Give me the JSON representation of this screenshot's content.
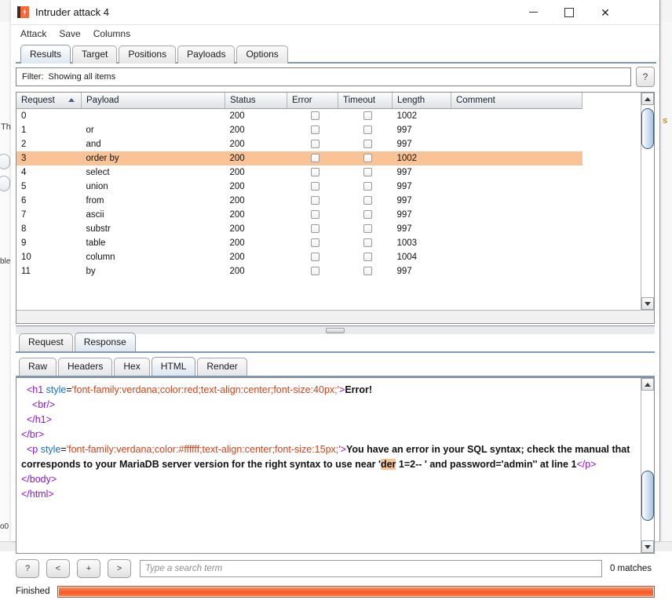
{
  "window": {
    "title": "Intruder attack 4",
    "icon": "burp-icon",
    "minimize": "–",
    "maximize": "□",
    "close": "✕"
  },
  "menu": {
    "items": [
      {
        "label": "Attack"
      },
      {
        "label": "Save"
      },
      {
        "label": "Columns"
      }
    ]
  },
  "top_tabs": [
    {
      "label": "Results",
      "selected": true
    },
    {
      "label": "Target",
      "selected": false
    },
    {
      "label": "Positions",
      "selected": false
    },
    {
      "label": "Payloads",
      "selected": false
    },
    {
      "label": "Options",
      "selected": false
    }
  ],
  "filter": {
    "label": "Filter:",
    "value": "Showing all items",
    "help_label": "?"
  },
  "results_table": {
    "columns": [
      {
        "key": "request",
        "label": "Request",
        "sorted": "asc"
      },
      {
        "key": "payload",
        "label": "Payload"
      },
      {
        "key": "status",
        "label": "Status"
      },
      {
        "key": "error",
        "label": "Error"
      },
      {
        "key": "timeout",
        "label": "Timeout"
      },
      {
        "key": "length",
        "label": "Length"
      },
      {
        "key": "comment",
        "label": "Comment"
      }
    ],
    "rows": [
      {
        "request": "0",
        "payload": "",
        "status": "200",
        "error": false,
        "timeout": false,
        "length": "1002",
        "comment": "",
        "selected": false
      },
      {
        "request": "1",
        "payload": "or",
        "status": "200",
        "error": false,
        "timeout": false,
        "length": "997",
        "comment": "",
        "selected": false
      },
      {
        "request": "2",
        "payload": "and",
        "status": "200",
        "error": false,
        "timeout": false,
        "length": "997",
        "comment": "",
        "selected": false
      },
      {
        "request": "3",
        "payload": "order by",
        "status": "200",
        "error": false,
        "timeout": false,
        "length": "1002",
        "comment": "",
        "selected": true
      },
      {
        "request": "4",
        "payload": "select",
        "status": "200",
        "error": false,
        "timeout": false,
        "length": "997",
        "comment": "",
        "selected": false
      },
      {
        "request": "5",
        "payload": "union",
        "status": "200",
        "error": false,
        "timeout": false,
        "length": "997",
        "comment": "",
        "selected": false
      },
      {
        "request": "6",
        "payload": "from",
        "status": "200",
        "error": false,
        "timeout": false,
        "length": "997",
        "comment": "",
        "selected": false
      },
      {
        "request": "7",
        "payload": "ascii",
        "status": "200",
        "error": false,
        "timeout": false,
        "length": "997",
        "comment": "",
        "selected": false
      },
      {
        "request": "8",
        "payload": "substr",
        "status": "200",
        "error": false,
        "timeout": false,
        "length": "997",
        "comment": "",
        "selected": false
      },
      {
        "request": "9",
        "payload": "table",
        "status": "200",
        "error": false,
        "timeout": false,
        "length": "1003",
        "comment": "",
        "selected": false
      },
      {
        "request": "10",
        "payload": "column",
        "status": "200",
        "error": false,
        "timeout": false,
        "length": "1004",
        "comment": "",
        "selected": false
      },
      {
        "request": "11",
        "payload": "by",
        "status": "200",
        "error": false,
        "timeout": false,
        "length": "997",
        "comment": "",
        "selected": false
      }
    ]
  },
  "message_tabs": [
    {
      "label": "Request",
      "selected": false
    },
    {
      "label": "Response",
      "selected": true
    }
  ],
  "view_tabs": [
    {
      "label": "Raw",
      "selected": false
    },
    {
      "label": "Headers",
      "selected": false
    },
    {
      "label": "Hex",
      "selected": false
    },
    {
      "label": "HTML",
      "selected": true
    },
    {
      "label": "Render",
      "selected": false
    }
  ],
  "response_body": {
    "lines": [
      [
        {
          "t": "  ",
          "c": "plain"
        },
        {
          "t": "<h1 ",
          "c": "tag"
        },
        {
          "t": "style",
          "c": "attr"
        },
        {
          "t": "=",
          "c": "plain"
        },
        {
          "t": "'font-family:verdana;color:red;text-align:center;font-size:40px;'",
          "c": "val"
        },
        {
          "t": ">",
          "c": "tag"
        },
        {
          "t": "Error!",
          "c": "text"
        }
      ],
      [
        {
          "t": "    ",
          "c": "plain"
        },
        {
          "t": "<br/>",
          "c": "tag"
        }
      ],
      [
        {
          "t": "  ",
          "c": "plain"
        },
        {
          "t": "</h1>",
          "c": "tag"
        }
      ],
      [
        {
          "t": "</br>",
          "c": "tag"
        }
      ],
      [
        {
          "t": "  ",
          "c": "plain"
        },
        {
          "t": "<p ",
          "c": "tag"
        },
        {
          "t": "style",
          "c": "attr"
        },
        {
          "t": "=",
          "c": "plain"
        },
        {
          "t": "'font-family:verdana;color:#ffffff;text-align:center;font-size:15px;'",
          "c": "val"
        },
        {
          "t": ">",
          "c": "tag"
        },
        {
          "t": "You have an error in your SQL syntax; check the manual that corresponds to your MariaDB server version for the right syntax to use near '",
          "c": "text"
        },
        {
          "t": "der",
          "c": "text-hl"
        },
        {
          "t": " 1=2-- ' and password='admin'' at line 1",
          "c": "text"
        },
        {
          "t": "</p>",
          "c": "tag"
        }
      ],
      [
        {
          "t": "</body>",
          "c": "tag"
        }
      ],
      [
        {
          "t": "</html>",
          "c": "tag"
        }
      ]
    ]
  },
  "search": {
    "help_label": "?",
    "prev_label": "<",
    "add_label": "+",
    "next_label": ">",
    "placeholder": "Type a search term",
    "value": "",
    "matches": "0 matches"
  },
  "status": {
    "text": "Finished",
    "progress_percent": 100
  },
  "colors": {
    "selection": "#f9c396",
    "accent": "#7f98b5",
    "progress": "#f4592a",
    "brand_orange": "#ff6633"
  },
  "background": {
    "left_fragments": [
      "Th",
      "ble",
      "o0"
    ],
    "right_fragment": "s"
  }
}
